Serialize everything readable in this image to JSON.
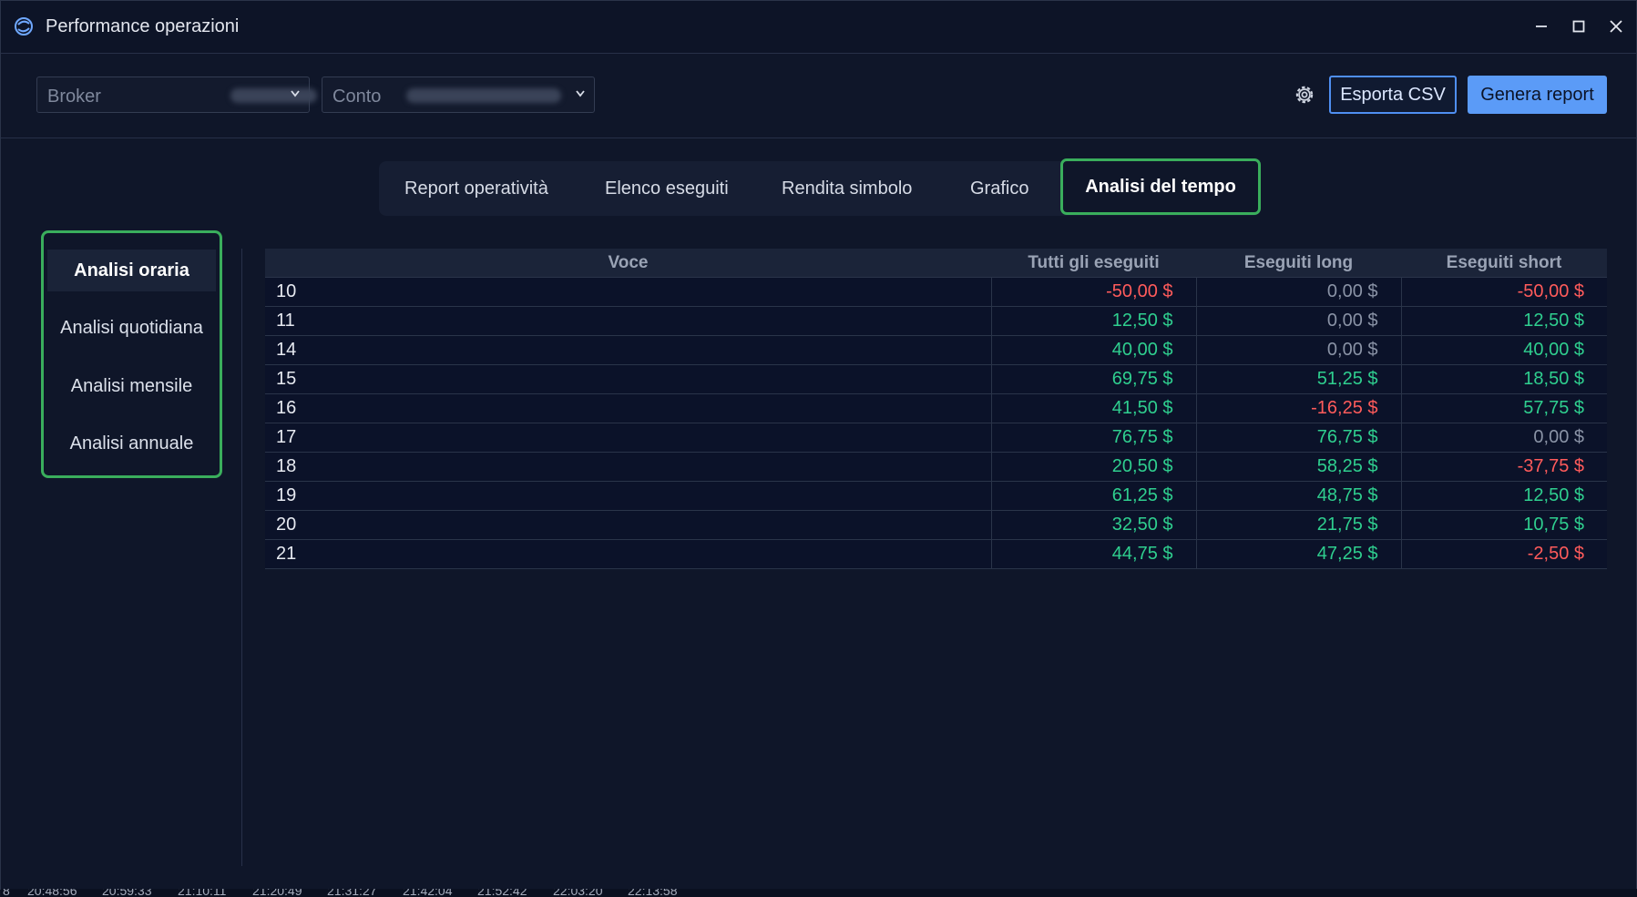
{
  "window": {
    "title": "Performance operazioni"
  },
  "toolbar": {
    "broker": {
      "label": "Broker"
    },
    "account": {
      "label": "Conto"
    },
    "export_label": "Esporta CSV",
    "generate_label": "Genera report"
  },
  "tabs": [
    {
      "label": "Report operatività",
      "active": false
    },
    {
      "label": "Elenco eseguiti",
      "active": false
    },
    {
      "label": "Rendita simbolo",
      "active": false
    },
    {
      "label": "Grafico",
      "active": false
    },
    {
      "label": "Analisi del tempo",
      "active": true
    }
  ],
  "sidebar": {
    "items": [
      {
        "label": "Analisi oraria",
        "active": true
      },
      {
        "label": "Analisi quotidiana",
        "active": false
      },
      {
        "label": "Analisi mensile",
        "active": false
      },
      {
        "label": "Analisi annuale",
        "active": false
      }
    ]
  },
  "table": {
    "columns": [
      "Voce",
      "Tutti gli eseguiti",
      "Eseguiti long",
      "Eseguiti short"
    ],
    "rows": [
      [
        "10",
        "-50,00 $",
        "0,00 $",
        "-50,00 $"
      ],
      [
        "11",
        "12,50 $",
        "0,00 $",
        "12,50 $"
      ],
      [
        "14",
        "40,00 $",
        "0,00 $",
        "40,00 $"
      ],
      [
        "15",
        "69,75 $",
        "51,25 $",
        "18,50 $"
      ],
      [
        "16",
        "41,50 $",
        "-16,25 $",
        "57,75 $"
      ],
      [
        "17",
        "76,75 $",
        "76,75 $",
        "0,00 $"
      ],
      [
        "18",
        "20,50 $",
        "58,25 $",
        "-37,75 $"
      ],
      [
        "19",
        "61,25 $",
        "48,75 $",
        "12,50 $"
      ],
      [
        "20",
        "32,50 $",
        "21,75 $",
        "10,75 $"
      ],
      [
        "21",
        "44,75 $",
        "47,25 $",
        "-2,50 $"
      ]
    ]
  },
  "statusbar": {
    "times": [
      "8",
      "20:48:56",
      "20:59:33",
      "21:10:11",
      "21:20:49",
      "21:31:27",
      "21:42:04",
      "21:52:42",
      "22:03:20",
      "22:13:58"
    ]
  },
  "colors": {
    "positive": "#2fcf8f",
    "negative": "#ff5b5b",
    "zero": "#8a93a6",
    "accent": "#5b9bf7",
    "highlight": "#3aae5c"
  }
}
